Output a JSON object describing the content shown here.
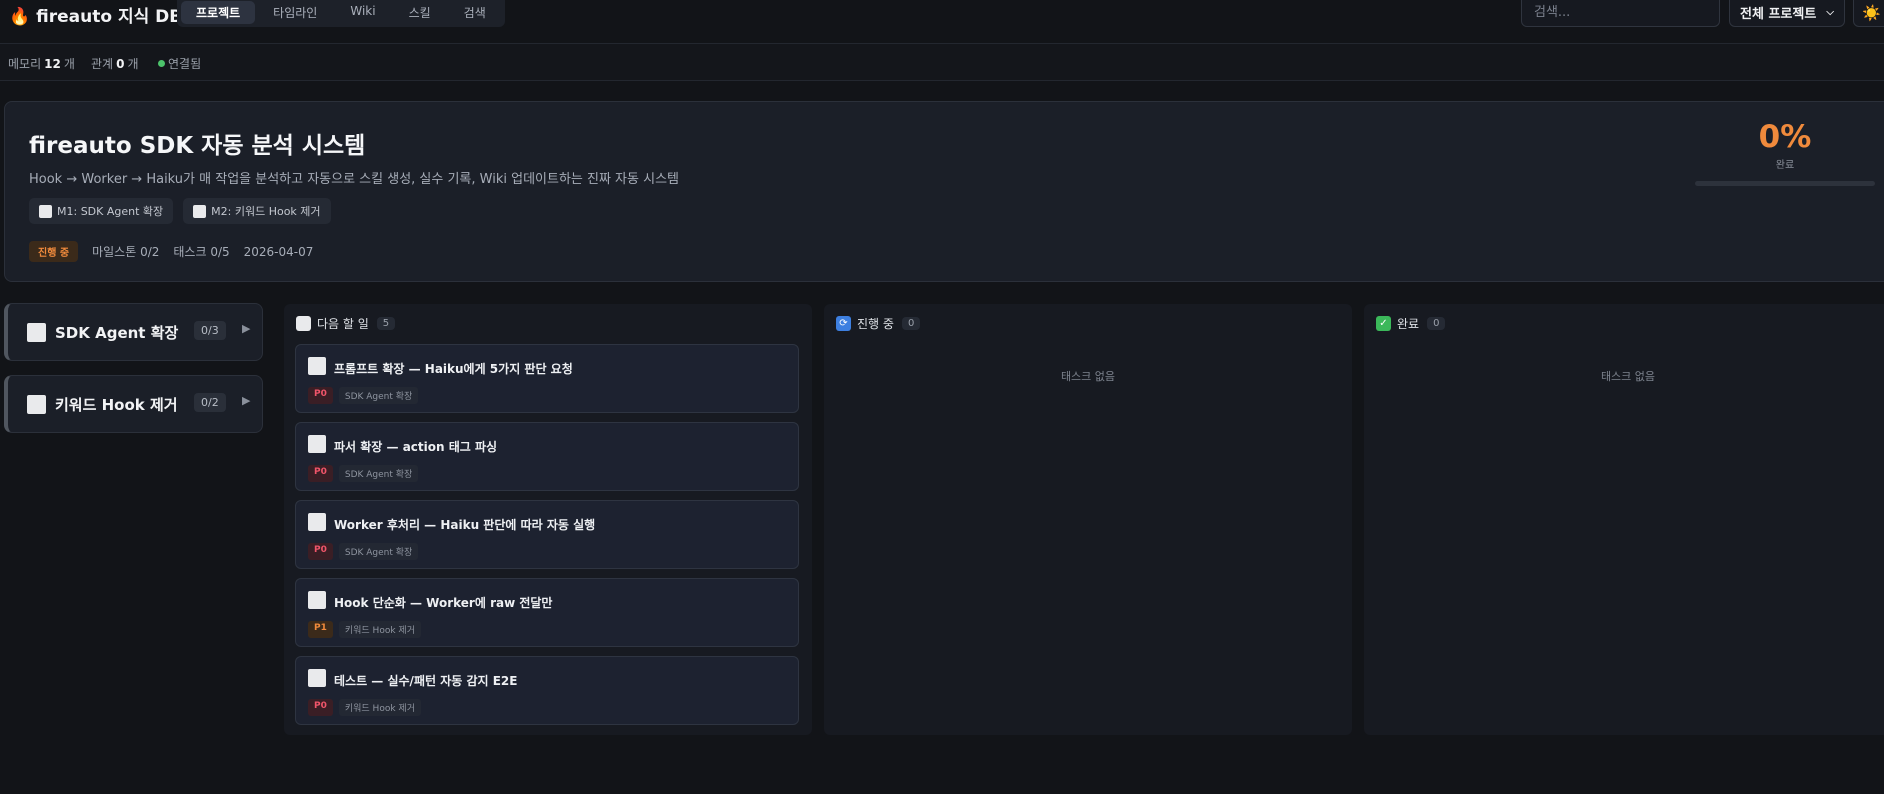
{
  "app": {
    "title": "fireauto 지식 DB",
    "nav_tabs": [
      {
        "label": "프로젝트",
        "active": true
      },
      {
        "label": "타임라인",
        "active": false
      },
      {
        "label": "Wiki",
        "active": false
      },
      {
        "label": "스킬",
        "active": false
      },
      {
        "label": "검색",
        "active": false
      }
    ],
    "search_placeholder": "검색...",
    "project_select": "전체 프로젝트"
  },
  "stats": {
    "memory_label": "메모리",
    "memory_count": "12",
    "memory_unit": "개",
    "relation_label": "관계",
    "relation_count": "0",
    "relation_unit": "개",
    "connection": "연결됨"
  },
  "project": {
    "title": "fireauto SDK 자동 분석 시스템",
    "description": "Hook → Worker → Haiku가 매 작업을 분석하고 자동으로 스킬 생성, 실수 기록, Wiki 업데이트하는 진짜 자동 시스템",
    "milestone_chips": [
      "M1: SDK Agent 확장",
      "M2: 키워드 Hook 제거"
    ],
    "status": "진행 중",
    "milestones_summary": "마일스톤 0/2",
    "tasks_summary": "태스크 0/5",
    "date": "2026-04-07",
    "progress_percent": "0%",
    "progress_label": "완료",
    "progress_value": 0
  },
  "milestones": [
    {
      "label": "SDK Agent 확장",
      "count": "0/3"
    },
    {
      "label": "키워드 Hook 제거",
      "count": "0/2"
    }
  ],
  "columns": {
    "todo": {
      "title": "다음 할 일",
      "count": "5",
      "tasks": [
        {
          "title": "프롬프트 확장 — Haiku에게 5가지 판단 요청",
          "priority": "P0",
          "milestone": "SDK Agent 확장"
        },
        {
          "title": "파서 확장 — action 태그 파싱",
          "priority": "P0",
          "milestone": "SDK Agent 확장"
        },
        {
          "title": "Worker 후처리 — Haiku 판단에 따라 자동 실행",
          "priority": "P0",
          "milestone": "SDK Agent 확장"
        },
        {
          "title": "Hook 단순화 — Worker에 raw 전달만",
          "priority": "P1",
          "milestone": "키워드 Hook 제거"
        },
        {
          "title": "테스트 — 실수/패턴 자동 감지 E2E",
          "priority": "P0",
          "milestone": "키워드 Hook 제거"
        }
      ]
    },
    "in_progress": {
      "title": "진행 중",
      "count": "0",
      "empty": "태스크 없음"
    },
    "done": {
      "title": "완료",
      "count": "0",
      "empty": "태스크 없음"
    }
  }
}
